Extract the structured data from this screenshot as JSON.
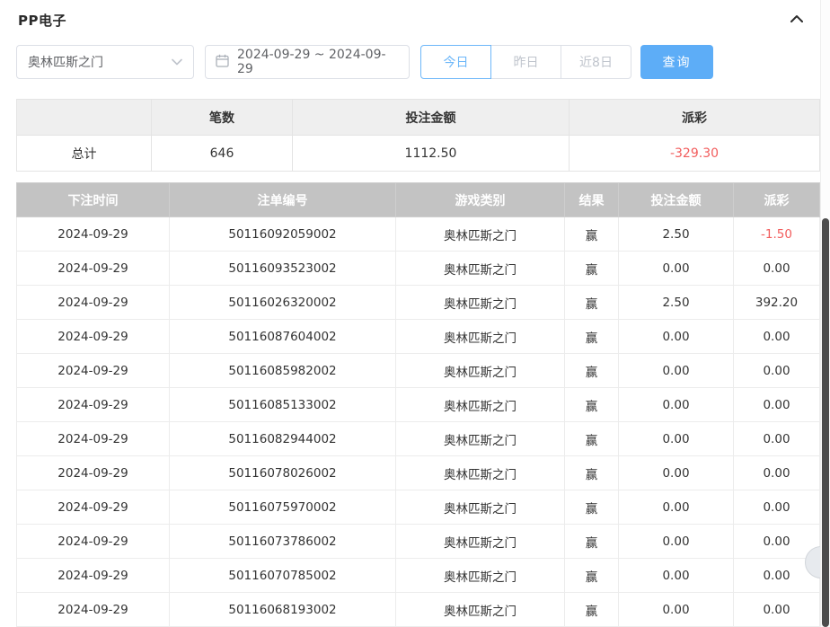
{
  "header": {
    "title": "PP电子"
  },
  "filters": {
    "game_select": {
      "value": "奥林匹斯之门"
    },
    "date_range": {
      "value": "2024-09-29 ~ 2024-09-29"
    },
    "quick_buttons": [
      {
        "key": "today",
        "label": "今日",
        "active": true
      },
      {
        "key": "yesterday",
        "label": "昨日",
        "active": false
      },
      {
        "key": "last-8-days",
        "label": "近8日",
        "active": false
      }
    ],
    "query_label": "查询"
  },
  "summary": {
    "headers": [
      "",
      "笔数",
      "投注金额",
      "派彩"
    ],
    "total_label": "总计",
    "count": "646",
    "bet_amount": "1112.50",
    "payout": "-329.30"
  },
  "table": {
    "headers": [
      "下注时间",
      "注单编号",
      "游戏类别",
      "结果",
      "投注金额",
      "派彩"
    ],
    "rows": [
      [
        "2024-09-29",
        "50116092059002",
        "奥林匹斯之门",
        "赢",
        "2.50",
        "-1.50"
      ],
      [
        "2024-09-29",
        "50116093523002",
        "奥林匹斯之门",
        "赢",
        "0.00",
        "0.00"
      ],
      [
        "2024-09-29",
        "50116026320002",
        "奥林匹斯之门",
        "赢",
        "2.50",
        "392.20"
      ],
      [
        "2024-09-29",
        "50116087604002",
        "奥林匹斯之门",
        "赢",
        "0.00",
        "0.00"
      ],
      [
        "2024-09-29",
        "50116085982002",
        "奥林匹斯之门",
        "赢",
        "0.00",
        "0.00"
      ],
      [
        "2024-09-29",
        "50116085133002",
        "奥林匹斯之门",
        "赢",
        "0.00",
        "0.00"
      ],
      [
        "2024-09-29",
        "50116082944002",
        "奥林匹斯之门",
        "赢",
        "0.00",
        "0.00"
      ],
      [
        "2024-09-29",
        "50116078026002",
        "奥林匹斯之门",
        "赢",
        "0.00",
        "0.00"
      ],
      [
        "2024-09-29",
        "50116075970002",
        "奥林匹斯之门",
        "赢",
        "0.00",
        "0.00"
      ],
      [
        "2024-09-29",
        "50116073786002",
        "奥林匹斯之门",
        "赢",
        "0.00",
        "0.00"
      ],
      [
        "2024-09-29",
        "50116070785002",
        "奥林匹斯之门",
        "赢",
        "0.00",
        "0.00"
      ],
      [
        "2024-09-29",
        "50116068193002",
        "奥林匹斯之门",
        "赢",
        "0.00",
        "0.00"
      ]
    ]
  },
  "colors": {
    "accent_blue": "#5dadf7",
    "negative_red": "#f25d5d",
    "table_header_gray": "#c3c3c3"
  }
}
